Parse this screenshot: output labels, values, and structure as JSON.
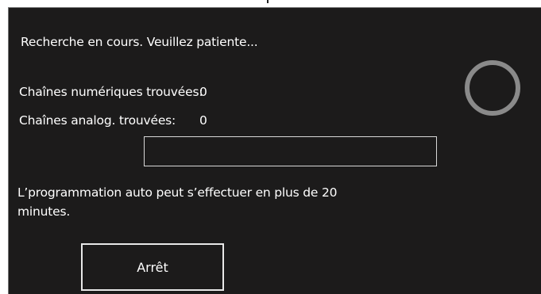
{
  "scan": {
    "status_text": "Recherche en cours. Veuillez patiente...",
    "digital_label": "Chaînes numériques trouvées:",
    "digital_count": "0",
    "analog_label": "Chaînes analog. trouvées:",
    "analog_count": "0",
    "progress_fraction": 0,
    "note": "L’programmation auto peut s’effectuer en plus de 20 minutes.",
    "stop_label": "Arrêt"
  },
  "icons": {
    "spinner": "loading-ring-icon"
  },
  "colors": {
    "background": "#1c1b1b",
    "text": "#ffffff",
    "spinner": "#8a8a8a",
    "border": "#e8e8e8"
  }
}
